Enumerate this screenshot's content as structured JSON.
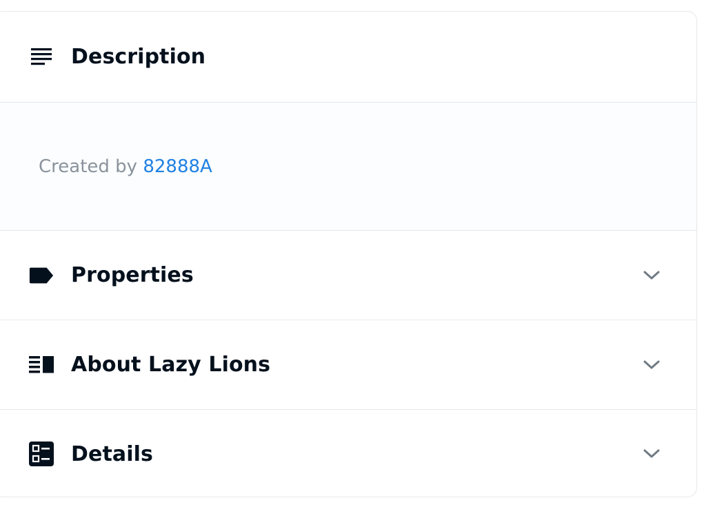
{
  "sections": {
    "description": {
      "title": "Description",
      "icon": "description-lines-icon",
      "created_by_label": "Created by",
      "creator": "82888A"
    },
    "properties": {
      "title": "Properties",
      "icon": "label-tag-icon"
    },
    "about": {
      "title": "About Lazy Lions",
      "icon": "vertical-split-icon"
    },
    "details": {
      "title": "Details",
      "icon": "ballot-icon"
    }
  },
  "colors": {
    "text_primary": "#04111d",
    "text_secondary": "#8a939b",
    "link": "#2081e2",
    "border": "#e5e8eb",
    "body_background": "#fbfdff"
  }
}
